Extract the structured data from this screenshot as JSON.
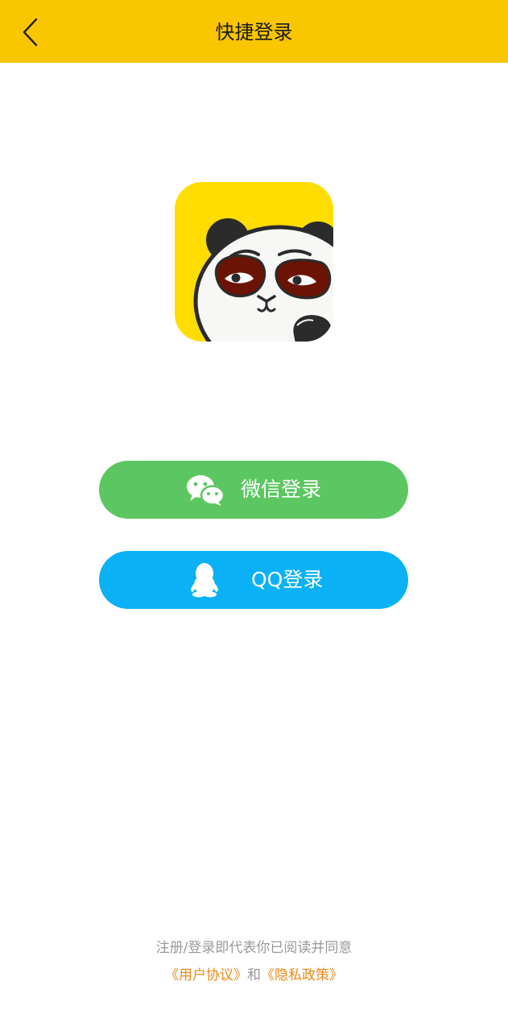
{
  "header": {
    "title": "快捷登录",
    "back_icon": "chevron-left-icon"
  },
  "logo": {
    "icon": "panda-app-logo",
    "background": "#FFDD00"
  },
  "buttons": {
    "wechat": {
      "label": "微信登录",
      "icon": "wechat-icon",
      "color": "#5CC762"
    },
    "qq": {
      "label": "QQ登录",
      "icon": "qq-penguin-icon",
      "color": "#0BB1F5"
    }
  },
  "agreement": {
    "text": "注册/登录即代表你已阅读并同意",
    "user_agreement": "《用户协议》",
    "and": "和",
    "privacy_policy": "《隐私政策》",
    "link_color": "#E88A1A"
  },
  "colors": {
    "header_bg": "#F9C600"
  }
}
